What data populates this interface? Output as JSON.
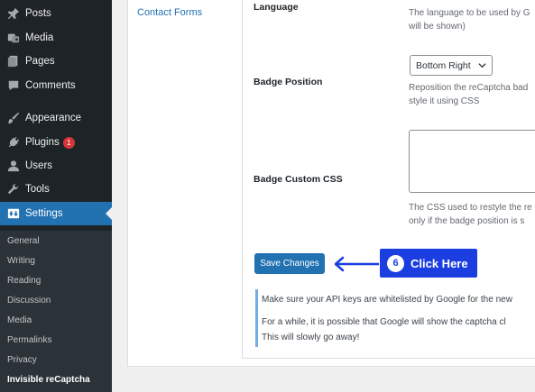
{
  "sidebar": {
    "items": [
      {
        "label": "Posts",
        "icon": "pin-icon"
      },
      {
        "label": "Media",
        "icon": "media-icon"
      },
      {
        "label": "Pages",
        "icon": "pages-icon"
      },
      {
        "label": "Comments",
        "icon": "comments-icon"
      },
      {
        "label": "Appearance",
        "icon": "paintbrush-icon"
      },
      {
        "label": "Plugins",
        "icon": "plugin-icon",
        "badge": "1"
      },
      {
        "label": "Users",
        "icon": "users-icon"
      },
      {
        "label": "Tools",
        "icon": "tools-icon"
      },
      {
        "label": "Settings",
        "icon": "settings-icon"
      }
    ],
    "submenu": [
      "General",
      "Writing",
      "Reading",
      "Discussion",
      "Media",
      "Permalinks",
      "Privacy",
      "Invisible reCaptcha"
    ]
  },
  "left_link": "Contact Forms",
  "fields": {
    "language": {
      "label": "Language",
      "desc1": "The language to be used by G",
      "desc2": "will be shown)"
    },
    "badge_position": {
      "label": "Badge Position",
      "value": "Bottom Right",
      "desc1": "Reposition the reCaptcha bad",
      "desc2": "style it using CSS"
    },
    "badge_css": {
      "label": "Badge Custom CSS",
      "desc1": "The CSS used to restyle the re",
      "desc2": "only if the badge position is s"
    }
  },
  "save_label": "Save Changes",
  "callout": {
    "number": "6",
    "text": "Click Here"
  },
  "notice": {
    "line1": "Make sure your API keys are whitelisted by Google for the new",
    "line2": "For a while, it is possible that Google will show the captcha cl",
    "line3": "This will slowly go away!"
  },
  "colors": {
    "sidebar_bg": "#1d2327",
    "accent": "#2271b1",
    "badge": "#d63638",
    "callout": "#1a3ee0",
    "notice_border": "#72aee6"
  }
}
